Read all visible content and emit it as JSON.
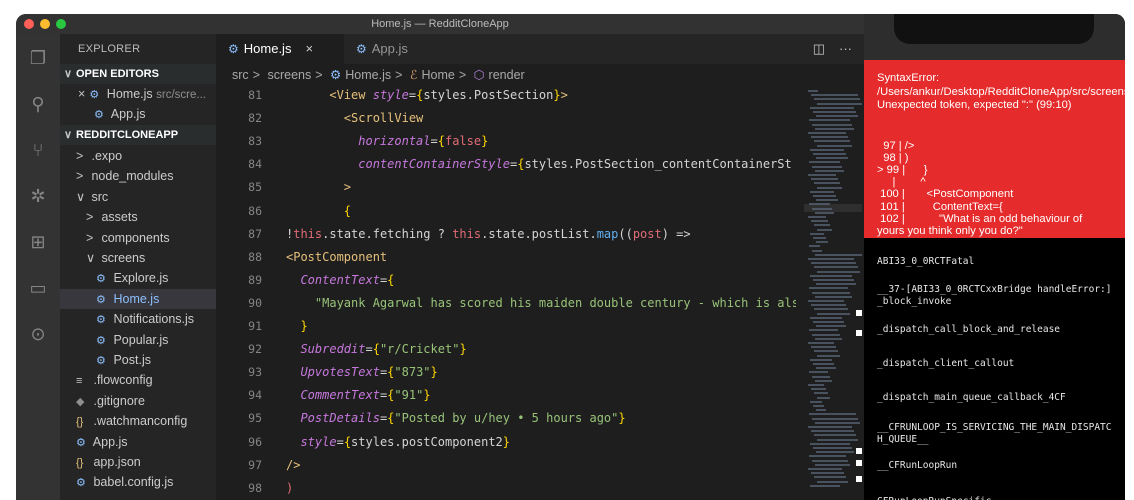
{
  "window": {
    "title": "Home.js — RedditCloneApp"
  },
  "explorer": {
    "header": "EXPLORER",
    "open_editors_label": "OPEN EDITORS",
    "open_editors": [
      {
        "name": "Home.js",
        "detail": "src/scre..."
      },
      {
        "name": "App.js",
        "detail": ""
      }
    ],
    "project_label": "REDDITCLONEAPP",
    "tree": [
      {
        "name": ".expo",
        "chev": ">",
        "indent": 1
      },
      {
        "name": "node_modules",
        "chev": ">",
        "indent": 1
      },
      {
        "name": "src",
        "chev": "∨",
        "indent": 1
      },
      {
        "name": "assets",
        "chev": ">",
        "indent": 2
      },
      {
        "name": "components",
        "chev": ">",
        "indent": 2
      },
      {
        "name": "screens",
        "chev": "∨",
        "indent": 2
      },
      {
        "name": "Explore.js",
        "icon": "⚙",
        "indent": 3
      },
      {
        "name": "Home.js",
        "icon": "⚙",
        "indent": 3,
        "selected": true
      },
      {
        "name": "Notifications.js",
        "icon": "⚙",
        "indent": 3
      },
      {
        "name": "Popular.js",
        "icon": "⚙",
        "indent": 3
      },
      {
        "name": "Post.js",
        "icon": "⚙",
        "indent": 3
      },
      {
        "name": ".flowconfig",
        "icon": "≡",
        "indent": 1
      },
      {
        "name": ".gitignore",
        "icon": "◆",
        "indent": 1
      },
      {
        "name": ".watchmanconfig",
        "icon": "{}",
        "indent": 1
      },
      {
        "name": "App.js",
        "icon": "⚙",
        "indent": 1
      },
      {
        "name": "app.json",
        "icon": "{}",
        "indent": 1
      },
      {
        "name": "babel.config.js",
        "icon": "⚙",
        "indent": 1
      }
    ]
  },
  "tabs": [
    {
      "label": "Home.js",
      "active": true
    },
    {
      "label": "App.js",
      "active": false
    }
  ],
  "breadcrumb": [
    "src",
    "screens",
    "Home.js",
    "Home",
    "render"
  ],
  "code_lines": [
    {
      "n": "81",
      "html": "      <span class='tg'>&lt;View</span> <span class='at'>style</span>=<span class='b'>{</span>styles.PostSection<span class='b'>}</span><span class='tg'>&gt;</span>"
    },
    {
      "n": "82",
      "html": "        <span class='tg'>&lt;ScrollView</span>"
    },
    {
      "n": "83",
      "html": "          <span class='at'>horizontal</span>=<span class='b'>{</span><span class='k'>false</span><span class='b'>}</span>"
    },
    {
      "n": "84",
      "html": "          <span class='at'>contentContainerStyle</span>=<span class='b'>{</span>styles.PostSection_contentContainerSt"
    },
    {
      "n": "85",
      "html": "        <span class='tg'>&gt;</span>"
    },
    {
      "n": "86",
      "html": "        <span class='b'>{</span>"
    },
    {
      "n": "87",
      "html": "!<span class='k'>this</span>.state.fetching ? <span class='k'>this</span>.state.postList.<span class='fn'>map</span>((<span class='k'>post</span>) =&gt;"
    },
    {
      "n": "88",
      "html": "<span class='tg'>&lt;PostComponent</span>"
    },
    {
      "n": "89",
      "html": "  <span class='at'>ContentText</span>=<span class='b'>{</span>"
    },
    {
      "n": "90",
      "html": "    <span class='s'>\"Mayank Agarwal has scored his maiden double century - which is also</span>"
    },
    {
      "n": "91",
      "html": "  <span class='b'>}</span>"
    },
    {
      "n": "92",
      "html": "  <span class='at'>Subreddit</span>=<span class='b'>{</span><span class='s'>\"r/Cricket\"</span><span class='b'>}</span>"
    },
    {
      "n": "93",
      "html": "  <span class='at'>UpvotesText</span>=<span class='b'>{</span><span class='s'>\"873\"</span><span class='b'>}</span>"
    },
    {
      "n": "94",
      "html": "  <span class='at'>CommentText</span>=<span class='b'>{</span><span class='s'>\"91\"</span><span class='b'>}</span>"
    },
    {
      "n": "95",
      "html": "  <span class='at'>PostDetails</span>=<span class='b'>{</span><span class='s'>\"Posted by u/hey • 5 hours ago\"</span><span class='b'>}</span>"
    },
    {
      "n": "96",
      "html": "  <span class='at'>style</span>=<span class='b'>{</span>styles.postComponent2<span class='b'>}</span>"
    },
    {
      "n": "97",
      "html": "<span class='tg'>/&gt;</span>"
    },
    {
      "n": "98",
      "html": "<span class='k'>)</span>"
    }
  ],
  "error": {
    "title": "SyntaxError: /Users/ankur/Desktop/RedditCloneApp/src/screens/Home.js: Unexpected token, expected \":\" (99:10)",
    "code": [
      "  97 | />",
      "  98 | )",
      "> 99 |      }",
      "     |        ^",
      " 100 |       <PostComponent",
      " 101 |         ContentText={",
      " 102 |           \"What is an odd behaviour of",
      "yours you think only you do?\""
    ]
  },
  "stack_trace": [
    "ABI33_0_0RCTFatal",
    "__37-[ABI33_0_0RCTCxxBridge handleError:]_block_invoke",
    "_dispatch_call_block_and_release",
    "_dispatch_client_callout",
    "_dispatch_main_queue_callback_4CF",
    "__CFRUNLOOP_IS_SERVICING_THE_MAIN_DISPATCH_QUEUE__",
    "__CFRunLoopRun",
    "CFRunLoopRunSpecific"
  ]
}
